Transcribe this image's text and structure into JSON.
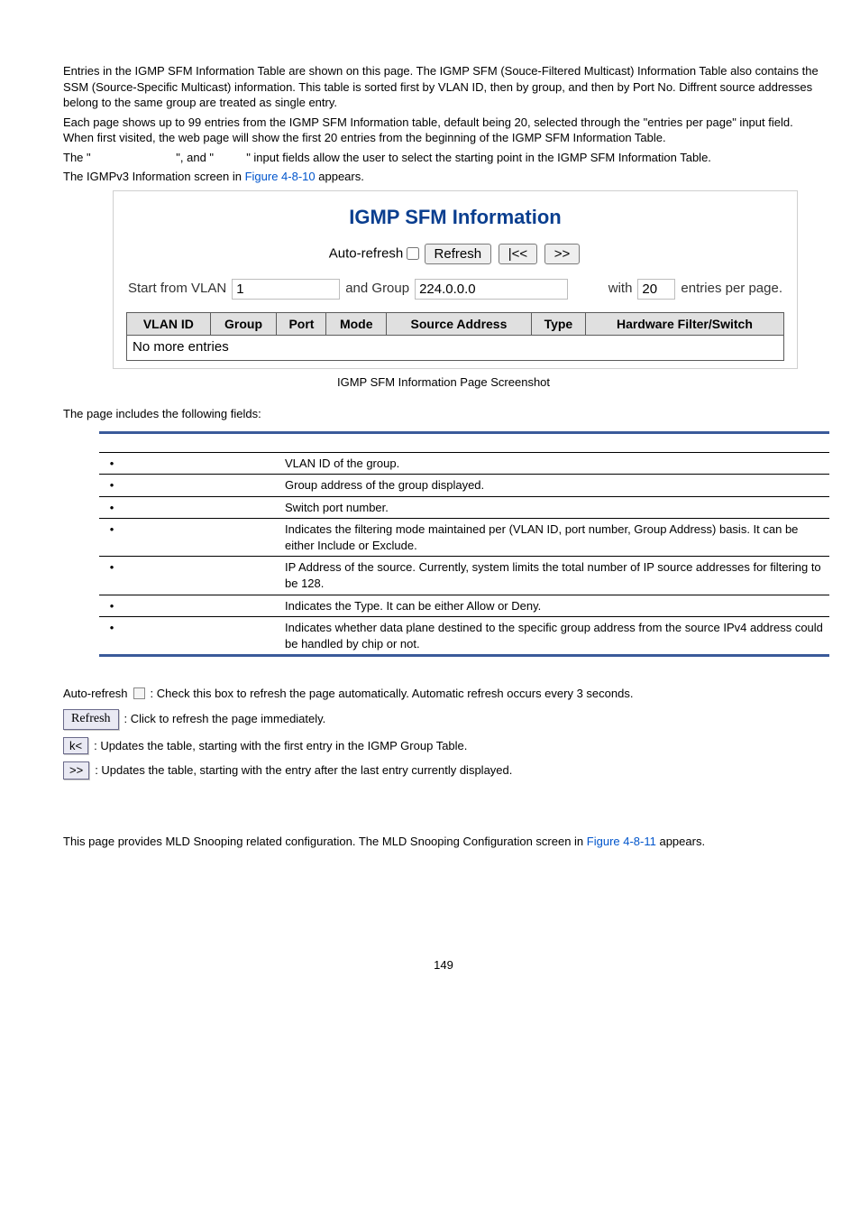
{
  "intro": {
    "p1": "Entries in the IGMP SFM Information Table are shown on this page. The IGMP SFM (Souce-Filtered Multicast) Information Table also contains the SSM (Source-Specific Multicast) information. This table is sorted first by VLAN ID, then by group, and then by Port No. Diffrent source addresses belong to the same group are treated as single entry.",
    "p2": "Each page shows up to 99 entries from the IGMP SFM Information table, default being 20, selected through the \"entries per page\" input field. When first visited, the web page will show the first 20 entries from the beginning of the IGMP SFM Information Table.",
    "p3a": "The \"",
    "p3b": "\", and \"",
    "p3c": "\" input fields allow the user to select the starting point in the IGMP SFM Information Table.",
    "p4a": "The IGMPv3 Information screen in ",
    "p4link": "Figure 4-8-10",
    "p4b": " appears."
  },
  "figure": {
    "title": "IGMP SFM Information",
    "autorefresh_label": "Auto-refresh",
    "refresh_btn": "Refresh",
    "first_btn": "|<<",
    "next_btn": ">>",
    "start_label": "Start from VLAN",
    "start_value": "1",
    "group_label": "and Group",
    "group_value": "224.0.0.0",
    "with_label": "with",
    "entries_value": "20",
    "entries_suffix": "entries per page.",
    "headers": [
      "VLAN ID",
      "Group",
      "Port",
      "Mode",
      "Source Address",
      "Type",
      "Hardware Filter/Switch"
    ],
    "empty_row": "No more entries",
    "caption": "IGMP SFM Information Page Screenshot"
  },
  "fields": {
    "lead": "The page includes the following fields:",
    "rows": [
      "VLAN ID of the group.",
      "Group address of the group displayed.",
      "Switch port number.",
      "Indicates the filtering mode maintained per (VLAN ID, port number, Group Address) basis. It can be either Include or Exclude.",
      "IP Address of the source. Currently, system limits the total number of IP source addresses for filtering to be 128.",
      "Indicates the Type. It can be either Allow or Deny.",
      "Indicates whether data plane destined to the specific group address from the source IPv4 address could be handled by chip or not."
    ]
  },
  "buttons": {
    "auto_pre": "Auto-refresh ",
    "auto_post": ": Check this box to refresh the page automatically. Automatic refresh occurs every 3 seconds.",
    "refresh_label": "Refresh",
    "refresh_text": ": Click to refresh the page immediately.",
    "first_label": "k<",
    "first_text": ": Updates the table, starting with the first entry in the IGMP Group Table.",
    "next_label": ">>",
    "next_text": ": Updates the table, starting with the entry after the last entry currently displayed."
  },
  "footer": {
    "p1a": "This page provides MLD Snooping related configuration. The MLD Snooping Configuration screen in ",
    "p1link": "Figure 4-8-11",
    "p1b": " appears."
  },
  "page_number": "149"
}
